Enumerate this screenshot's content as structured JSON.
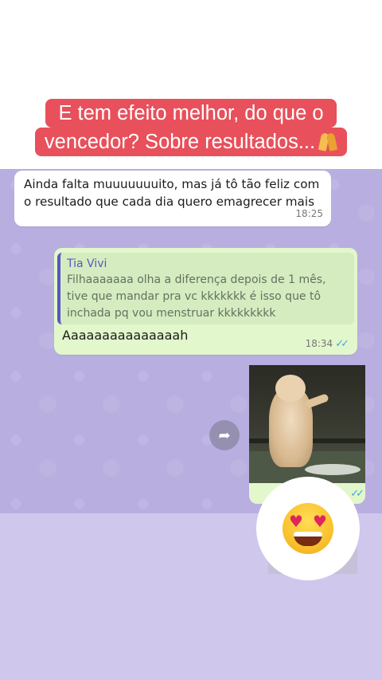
{
  "caption": {
    "line1": "E tem efeito melhor, do que o",
    "line2": "vencedor? Sobre resultados..."
  },
  "messages": {
    "incoming": {
      "text": "Ainda falta muuuuuuuito, mas já tô tão feliz com o resultado que cada dia quero emagrecer mais",
      "time": "18:25"
    },
    "outgoing": {
      "quote_author": "Tia Vivi",
      "quote_text": "Filhaaaaaaa olha a diferença depois de 1 mês, tive que mandar pra vc kkkkkkk é isso que tô inchada pq vou menstruar kkkkkkkkk",
      "text": "Aaaaaaaaaaaaaaah",
      "time": "18:34"
    }
  },
  "colors": {
    "caption_bg": "#e8505b",
    "chat_bg": "#b9aee0",
    "outgoing_bubble": "#e2f7cb",
    "quote_accent": "#5a55c6",
    "read_check": "#4aa3df"
  },
  "icons": {
    "caption_emoji": "folded-hands-icon",
    "share": "forward-icon",
    "reaction": "heart-eyes-emoji"
  }
}
